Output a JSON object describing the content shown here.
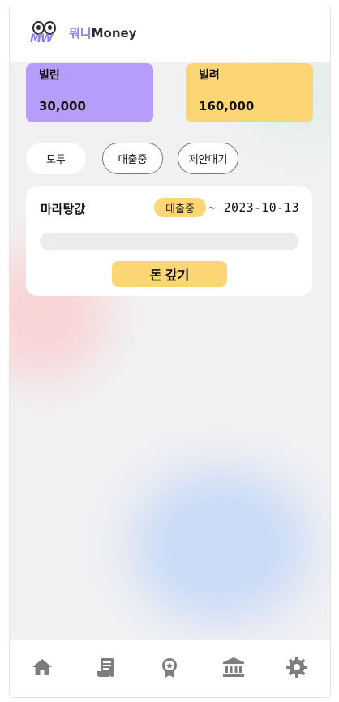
{
  "app": {
    "logo_mark": "MW",
    "name_korean": "뭐니",
    "name_english": "Money"
  },
  "summary": {
    "lend": {
      "label": "빌린",
      "amount": "30,000",
      "color": "#b79dfa"
    },
    "borrow": {
      "label": "빌려",
      "amount": "160,000",
      "color": "#fcd674"
    }
  },
  "filters": {
    "all": "모두",
    "lending": "대출중",
    "pending": "제안대기"
  },
  "loans": [
    {
      "title": "마라탕값",
      "status": "대출중",
      "due": "~ 2023-10-13",
      "progress": 0,
      "pay_label": "돈 갚기"
    }
  ],
  "nav": {
    "icons": [
      "home-icon",
      "ledger-icon",
      "award-icon",
      "bank-icon",
      "settings-icon"
    ],
    "active_color": "#7d7d7d"
  }
}
